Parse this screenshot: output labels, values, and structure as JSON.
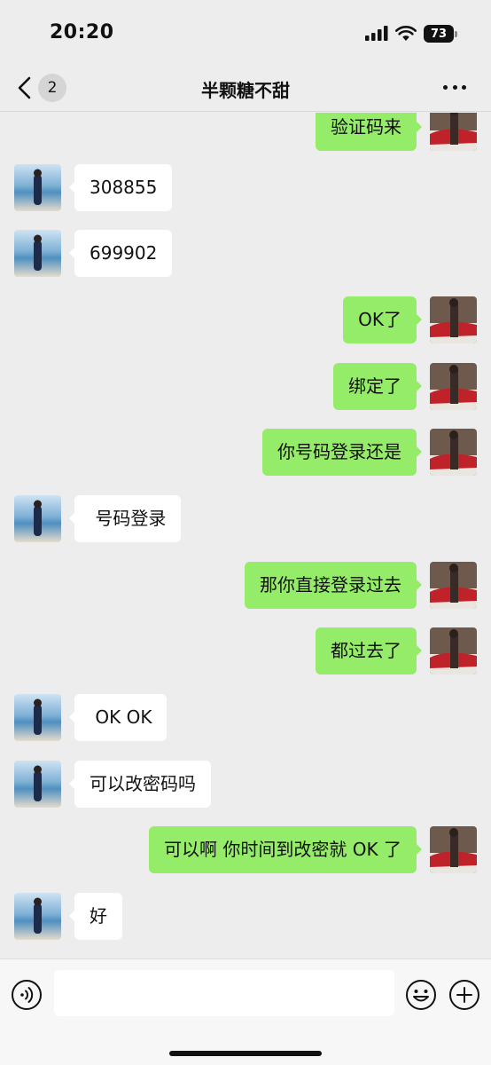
{
  "status_bar": {
    "time": "20:20",
    "battery": "73"
  },
  "header": {
    "title": "半颗糖不甜",
    "unread_count": "2"
  },
  "messages": [
    {
      "side": "right",
      "text": "验证码来"
    },
    {
      "side": "left",
      "text": "308855"
    },
    {
      "side": "left",
      "text": "699902"
    },
    {
      "side": "right",
      "text": "OK了"
    },
    {
      "side": "right",
      "text": "绑定了"
    },
    {
      "side": "right",
      "text": "你号码登录还是"
    },
    {
      "side": "left",
      "text": " 号码登录"
    },
    {
      "side": "right",
      "text": "那你直接登录过去"
    },
    {
      "side": "right",
      "text": "都过去了"
    },
    {
      "side": "left",
      "text": " OK OK"
    },
    {
      "side": "left",
      "text": "可以改密码吗"
    },
    {
      "side": "right",
      "text": "可以啊 你时间到改密就 OK 了"
    },
    {
      "side": "left",
      "text": "好"
    }
  ],
  "input": {
    "value": ""
  },
  "colors": {
    "background": "#ededed",
    "sent_bubble": "#95ec69",
    "received_bubble": "#ffffff"
  },
  "icons": {
    "back": "chevron-left-icon",
    "more": "more-dots-icon",
    "voice": "voice-icon",
    "emoji": "emoji-icon",
    "plus": "plus-icon"
  }
}
